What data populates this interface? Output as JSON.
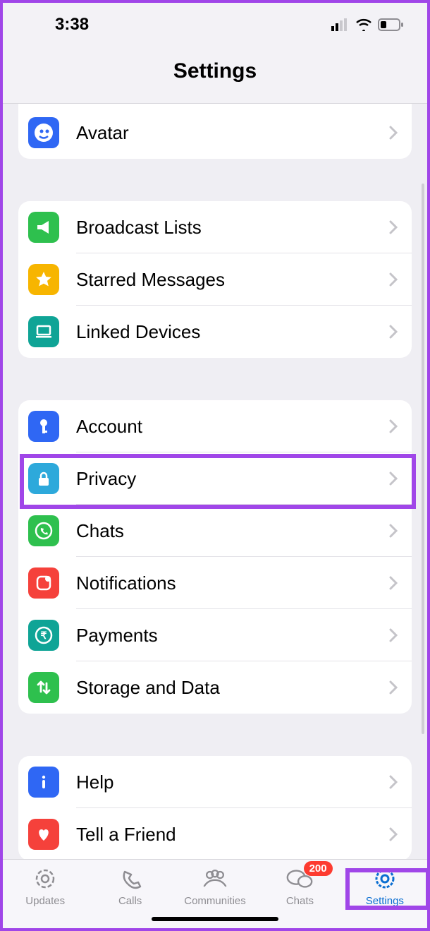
{
  "status": {
    "time": "3:38"
  },
  "header": {
    "title": "Settings"
  },
  "sections": [
    {
      "rows": [
        {
          "name": "avatar",
          "label": "Avatar",
          "icon": "avatar",
          "color": "#2f67f4"
        }
      ]
    },
    {
      "rows": [
        {
          "name": "broadcast",
          "label": "Broadcast Lists",
          "icon": "megaphone",
          "color": "#2ec04e"
        },
        {
          "name": "starred",
          "label": "Starred Messages",
          "icon": "star",
          "color": "#f7b500"
        },
        {
          "name": "linked",
          "label": "Linked Devices",
          "icon": "laptop",
          "color": "#0fa496"
        }
      ]
    },
    {
      "rows": [
        {
          "name": "account",
          "label": "Account",
          "icon": "key",
          "color": "#2f67f4"
        },
        {
          "name": "privacy",
          "label": "Privacy",
          "icon": "lock",
          "color": "#2da9db"
        },
        {
          "name": "chats",
          "label": "Chats",
          "icon": "whatsapp",
          "color": "#2ec04e"
        },
        {
          "name": "notifications",
          "label": "Notifications",
          "icon": "notif",
          "color": "#f5413b"
        },
        {
          "name": "payments",
          "label": "Payments",
          "icon": "rupee",
          "color": "#0fa496"
        },
        {
          "name": "storage",
          "label": "Storage and Data",
          "icon": "updown",
          "color": "#2ec04e"
        }
      ]
    },
    {
      "rows": [
        {
          "name": "help",
          "label": "Help",
          "icon": "info",
          "color": "#2f67f4"
        },
        {
          "name": "tell",
          "label": "Tell a Friend",
          "icon": "heart",
          "color": "#f5413b"
        }
      ]
    }
  ],
  "tabs": [
    {
      "name": "updates",
      "label": "Updates",
      "icon": "status"
    },
    {
      "name": "calls",
      "label": "Calls",
      "icon": "phone"
    },
    {
      "name": "communities",
      "label": "Communities",
      "icon": "group"
    },
    {
      "name": "chats",
      "label": "Chats",
      "icon": "bubbles",
      "badge": "200"
    },
    {
      "name": "settings",
      "label": "Settings",
      "icon": "gear",
      "active": true
    }
  ]
}
